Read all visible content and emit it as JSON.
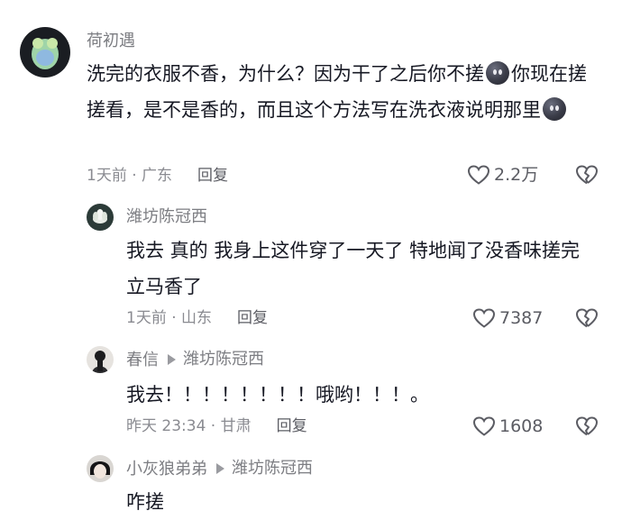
{
  "comments": [
    {
      "author": "荷初遇",
      "text_parts": [
        "洗完的衣服不香，为什么？因为干了之后你不搓",
        "你现在搓搓看，是不是香的，而且这个方法写在洗衣液说明那里"
      ],
      "time_location": "1天前 · 广东",
      "reply_label": "回复",
      "likes": "2.2万"
    },
    {
      "author": "潍坊陈冠西",
      "text": "我去 真的 我身上这件穿了一天了 特地闻了没香味搓完立马香了",
      "time_location": "1天前 · 山东",
      "reply_label": "回复",
      "likes": "7387"
    },
    {
      "author": "春信",
      "reply_to": "潍坊陈冠西",
      "text": "我去！！！！！！！！哦哟！！！。",
      "time_location": "昨天 23:34 · 甘肃",
      "reply_label": "回复",
      "likes": "1608"
    },
    {
      "author": "小灰狼弟弟",
      "reply_to": "潍坊陈冠西",
      "text": "咋搓"
    }
  ],
  "icons": {
    "like": "heart-outline-icon",
    "dislike": "broken-heart-icon",
    "inline_emoji": "dark-face-emoji-icon",
    "reply_arrow": "triangle-right-icon"
  },
  "colors": {
    "author": "#7c7d82",
    "text": "#161823",
    "meta": "#8a8b91"
  }
}
